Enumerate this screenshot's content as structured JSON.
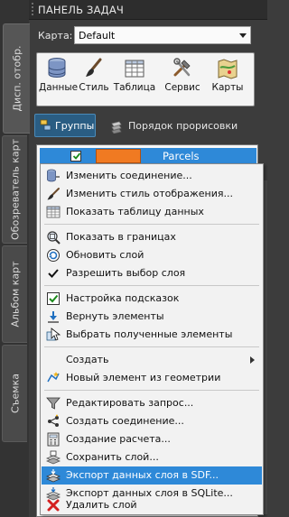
{
  "panel": {
    "title": "ПАНЕЛЬ ЗАДАЧ"
  },
  "side_tabs": [
    {
      "label": "Дисп. отобр.",
      "active": true
    },
    {
      "label": "Обозреватель карт",
      "active": false
    },
    {
      "label": "Альбом карт",
      "active": false
    },
    {
      "label": "Съемка",
      "active": false
    }
  ],
  "map": {
    "label": "Карта:",
    "selected": "Default"
  },
  "toolbar": [
    {
      "label": "Данные",
      "icon": "database-icon"
    },
    {
      "label": "Стиль",
      "icon": "brush-icon"
    },
    {
      "label": "Таблица",
      "icon": "table-icon"
    },
    {
      "label": "Сервис",
      "icon": "tools-icon"
    },
    {
      "label": "Карты",
      "icon": "map-icon"
    }
  ],
  "view_buttons": {
    "groups": "Группы",
    "draw_order": "Порядок прорисовки"
  },
  "layer": {
    "name": "Parcels",
    "visible": true,
    "swatch_color": "#f07a22"
  },
  "context_menu": {
    "items": [
      {
        "label": "Изменить соединение...",
        "icon": "connection-icon"
      },
      {
        "label": "Изменить стиль отображения...",
        "icon": "brush-icon"
      },
      {
        "label": "Показать таблицу данных",
        "icon": "table-icon"
      },
      {
        "label": "Показать в границах",
        "icon": "zoom-extents-icon"
      },
      {
        "label": "Обновить слой",
        "icon": "refresh-icon"
      },
      {
        "label": "Разрешить выбор слоя",
        "icon": "checkmark-icon"
      },
      {
        "label": "Настройка подсказок",
        "icon": "tooltip-settings-icon"
      },
      {
        "label": "Вернуть элементы",
        "icon": "retrieve-icon"
      },
      {
        "label": "Выбрать полученные элементы",
        "icon": "select-features-icon"
      },
      {
        "label": "Создать",
        "icon": "",
        "submenu": true
      },
      {
        "label": "Новый элемент из геометрии",
        "icon": "new-feature-icon"
      },
      {
        "label": "Редактировать запрос...",
        "icon": "filter-icon"
      },
      {
        "label": "Создать соединение...",
        "icon": "join-icon"
      },
      {
        "label": "Создание расчета...",
        "icon": "calculator-icon"
      },
      {
        "label": "Сохранить слой...",
        "icon": "save-layer-icon"
      },
      {
        "label": "Экспорт данных слоя в SDF...",
        "icon": "export-sdf-icon",
        "highlighted": true
      },
      {
        "label": "Экспорт данных слоя в SQLite...",
        "icon": "export-sqlite-icon"
      },
      {
        "label": "Удалить слой",
        "icon": "delete-icon"
      }
    ]
  },
  "colors": {
    "panel_bg": "#3c3c3c",
    "selection": "#2e89d8",
    "menu_bg": "#f2f2f2",
    "groups_active": "#2a5d83"
  }
}
